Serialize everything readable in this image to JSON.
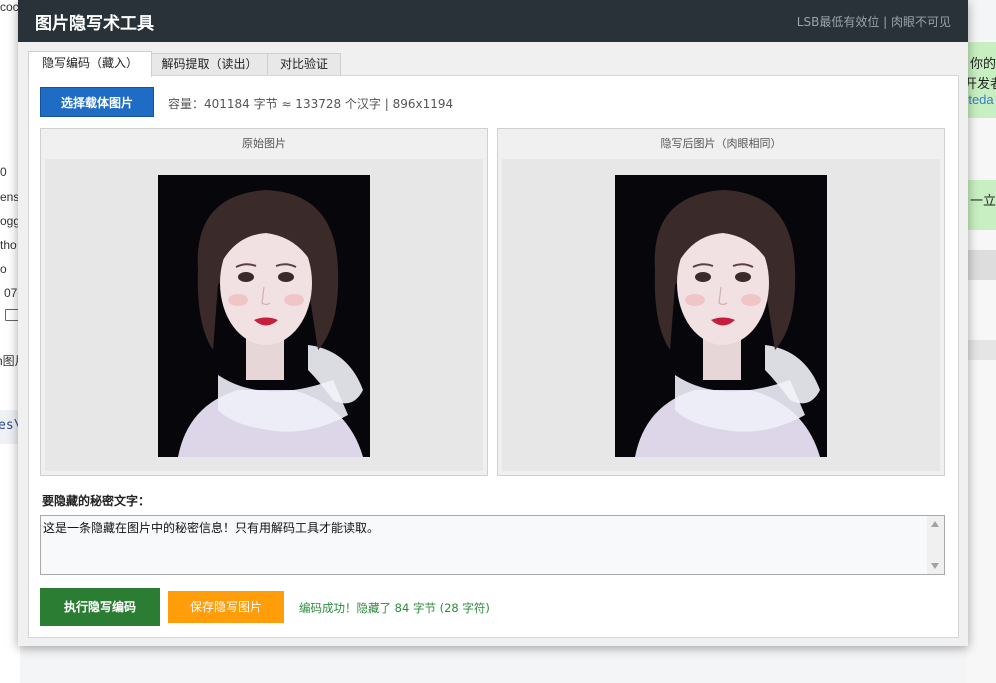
{
  "background": {
    "left_fragments": [
      "coc",
      "0",
      "ens",
      "ogg",
      "tho",
      "o",
      "07",
      "h图片",
      "es\\"
    ],
    "right_fragments": [
      "你的",
      "开发者",
      "rteda",
      "一立"
    ]
  },
  "window": {
    "title": "图片隐写术工具",
    "subtitle": "LSB最低有效位 | 肉眼不可见"
  },
  "tabs": [
    {
      "label": "隐写编码（藏入）",
      "active": true
    },
    {
      "label": "解码提取（读出）",
      "active": false
    },
    {
      "label": "对比验证",
      "active": false
    }
  ],
  "encode": {
    "select_button": "选择载体图片",
    "capacity_text": "容量：401184 字节 ≈ 133728 个汉字 | 896x1194",
    "original_caption": "原始图片",
    "stego_caption": "隐写后图片（肉眼相同）",
    "secret_label": "要隐藏的秘密文字：",
    "secret_text": "这是一条隐藏在图片中的秘密信息！只有用解码工具才能读取。",
    "execute_button": "执行隐写编码",
    "save_button": "保存隐写图片",
    "status_text": "编码成功！隐藏了 84 字节 (28 字符)"
  },
  "colors": {
    "titlebar": "#283238",
    "primary_button": "#1f6cc4",
    "execute_button": "#2c7d34",
    "save_button": "#ff9d0a",
    "success_text": "#2e8b3a"
  }
}
